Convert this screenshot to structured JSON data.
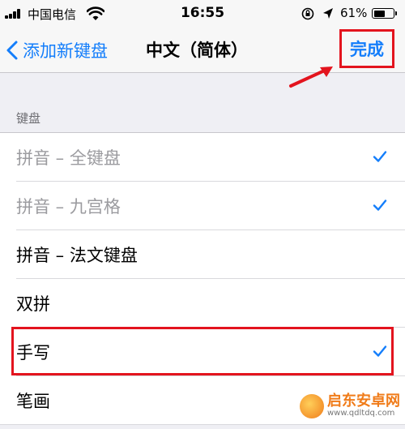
{
  "status_bar": {
    "carrier": "中国电信",
    "time": "16:55",
    "battery_percent": "61%",
    "battery_level": 0.61
  },
  "nav": {
    "back_label": "添加新键盘",
    "title": "中文（简体）",
    "done_label": "完成"
  },
  "section": {
    "header": "键盘",
    "items": [
      {
        "label": "拼音 – 全键盘",
        "checked": true,
        "dimmed": true
      },
      {
        "label": "拼音 – 九宫格",
        "checked": true,
        "dimmed": true
      },
      {
        "label": "拼音 – 法文键盘",
        "checked": false,
        "dimmed": false
      },
      {
        "label": "双拼",
        "checked": false,
        "dimmed": false
      },
      {
        "label": "手写",
        "checked": true,
        "dimmed": false
      },
      {
        "label": "笔画",
        "checked": false,
        "dimmed": false
      }
    ]
  },
  "watermark": {
    "title": "启东安卓网",
    "url": "www.qdltdq.com"
  },
  "colors": {
    "accent": "#147efb",
    "highlight": "#e3141e",
    "background": "#efeff4"
  },
  "icons": {
    "back": "chevron-left-icon",
    "check": "checkmark-icon",
    "arrow": "red-pointer-arrow-icon"
  }
}
